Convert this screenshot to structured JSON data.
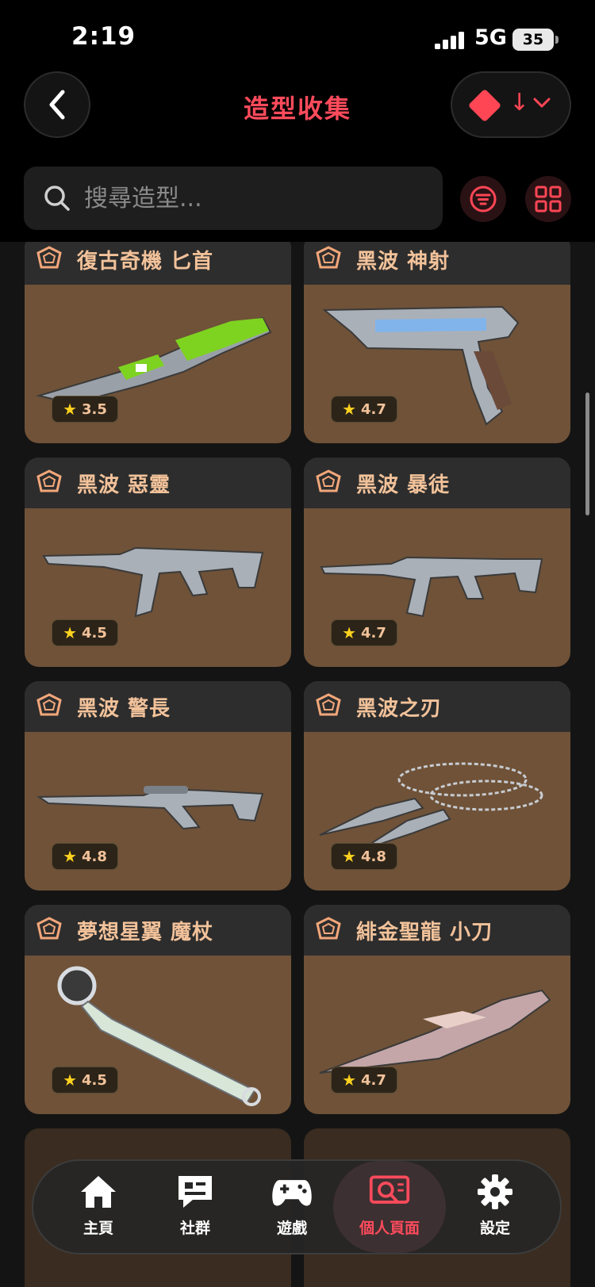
{
  "status": {
    "time": "2:19",
    "network": "5G",
    "battery": "35"
  },
  "header": {
    "title": "造型收集"
  },
  "search": {
    "placeholder": "搜尋造型..."
  },
  "colors": {
    "accent": "#ff4655",
    "card_bg": "#6f5238",
    "name": "#f2c29a"
  },
  "skins": [
    {
      "name": "復古奇機 匕首",
      "rating": "3.5",
      "icon": "knife"
    },
    {
      "name": "黑波 神射",
      "rating": "4.7",
      "icon": "pistol"
    },
    {
      "name": "黑波 惡靈",
      "rating": "4.5",
      "icon": "rifle"
    },
    {
      "name": "黑波 暴徒",
      "rating": "4.7",
      "icon": "rifle"
    },
    {
      "name": "黑波 警長",
      "rating": "4.8",
      "icon": "sniper"
    },
    {
      "name": "黑波之刃",
      "rating": "4.8",
      "icon": "kunai"
    },
    {
      "name": "夢想星翼 魔杖",
      "rating": "4.5",
      "icon": "wand"
    },
    {
      "name": "緋金聖龍 小刀",
      "rating": "4.7",
      "icon": "dagger"
    }
  ],
  "nav": [
    {
      "label": "主頁",
      "icon": "home-icon"
    },
    {
      "label": "社群",
      "icon": "chat-icon"
    },
    {
      "label": "遊戲",
      "icon": "gamepad-icon"
    },
    {
      "label": "個人頁面",
      "icon": "profile-search-icon",
      "active": true
    },
    {
      "label": "設定",
      "icon": "gear-icon"
    }
  ]
}
